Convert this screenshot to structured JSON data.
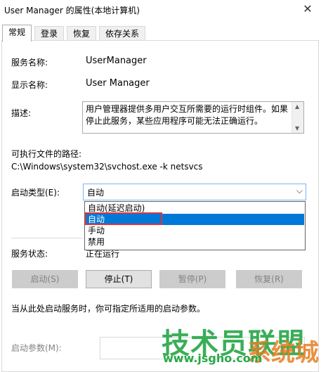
{
  "window": {
    "title": "User Manager 的属性(本地计算机)",
    "close_glyph": "✕"
  },
  "tabs": [
    {
      "label": "常规",
      "active": true
    },
    {
      "label": "登录",
      "active": false
    },
    {
      "label": "恢复",
      "active": false
    },
    {
      "label": "依存关系",
      "active": false
    }
  ],
  "general": {
    "service_name_label": "服务名称:",
    "service_name_value": "UserManager",
    "display_name_label": "显示名称:",
    "display_name_value": "User Manager",
    "description_label": "描述:",
    "description_value": "用户管理器提供多用户交互所需要的运行时组件。如果停止此服务，某些应用程序可能无法正确运行。",
    "path_label": "可执行文件的路径:",
    "path_value": "C:\\Windows\\system32\\svchost.exe -k netsvcs",
    "startup_type_label": "启动类型(E):",
    "startup_type_value": "自动",
    "startup_options": [
      "自动(延迟启动)",
      "自动",
      "手动",
      "禁用"
    ],
    "selected_option_index": 1,
    "status_label": "服务状态:",
    "status_value": "正在运行",
    "buttons": {
      "start": "启动(S)",
      "stop": "停止(T)",
      "pause": "暂停(P)",
      "resume": "恢复(R)"
    },
    "hint_text": "当从此处启动服务时，你可指定所适用的启动参数。",
    "start_params_label": "启动参数(M):",
    "start_params_value": ""
  },
  "watermark": {
    "text_main": "技术员联盟",
    "text_side": "系统城",
    "url": "www.jsgho.com"
  },
  "colors": {
    "selection": "#0078d7",
    "highlight_border": "#d9363e",
    "watermark_green": "#2aa84a",
    "watermark_orange": "#e67e22"
  }
}
